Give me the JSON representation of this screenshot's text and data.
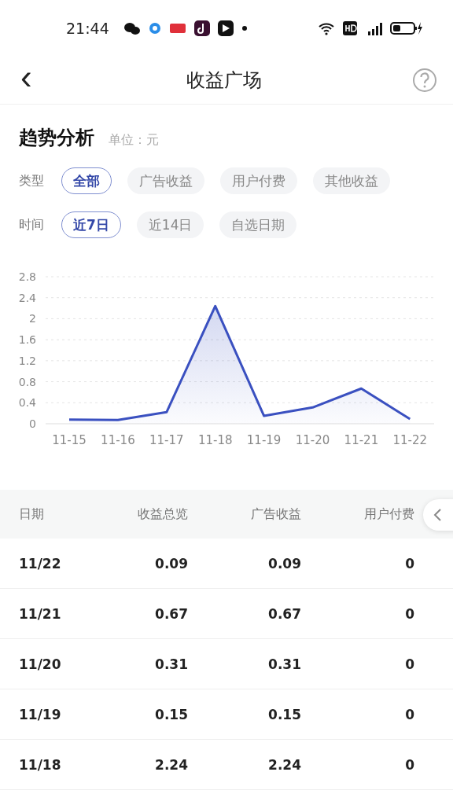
{
  "status_bar": {
    "time": "21:44"
  },
  "header": {
    "back": "‹",
    "title": "收益广场"
  },
  "trend": {
    "title": "趋势分析",
    "unit": "单位：元"
  },
  "filters": [
    {
      "label": "类型",
      "options": [
        {
          "label": "全部",
          "selected": true
        },
        {
          "label": "广告收益",
          "selected": false
        },
        {
          "label": "用户付费",
          "selected": false
        },
        {
          "label": "其他收益",
          "selected": false
        }
      ]
    },
    {
      "label": "时间",
      "options": [
        {
          "label": "近7日",
          "selected": true
        },
        {
          "label": "近14日",
          "selected": false
        },
        {
          "label": "自选日期",
          "selected": false
        }
      ]
    }
  ],
  "chart_data": {
    "type": "area",
    "categories": [
      "11-15",
      "11-16",
      "11-17",
      "11-18",
      "11-19",
      "11-20",
      "11-21",
      "11-22"
    ],
    "grid": true,
    "series": [
      {
        "color": "#3a50c0",
        "values": [
          0.08,
          0.07,
          0.22,
          2.24,
          0.15,
          0.31,
          0.67,
          0.09
        ]
      }
    ],
    "ylim": [
      0,
      2.8
    ],
    "yticks": [
      0,
      0.4,
      0.8,
      1.2,
      1.6,
      2,
      2.4,
      2.8
    ]
  },
  "table": {
    "columns": [
      "日期",
      "收益总览",
      "广告收益",
      "用户付费"
    ],
    "rows": [
      [
        "11/22",
        "0.09",
        "0.09",
        "0"
      ],
      [
        "11/21",
        "0.67",
        "0.67",
        "0"
      ],
      [
        "11/20",
        "0.31",
        "0.31",
        "0"
      ],
      [
        "11/19",
        "0.15",
        "0.15",
        "0"
      ],
      [
        "11/18",
        "2.24",
        "2.24",
        "0"
      ]
    ]
  }
}
